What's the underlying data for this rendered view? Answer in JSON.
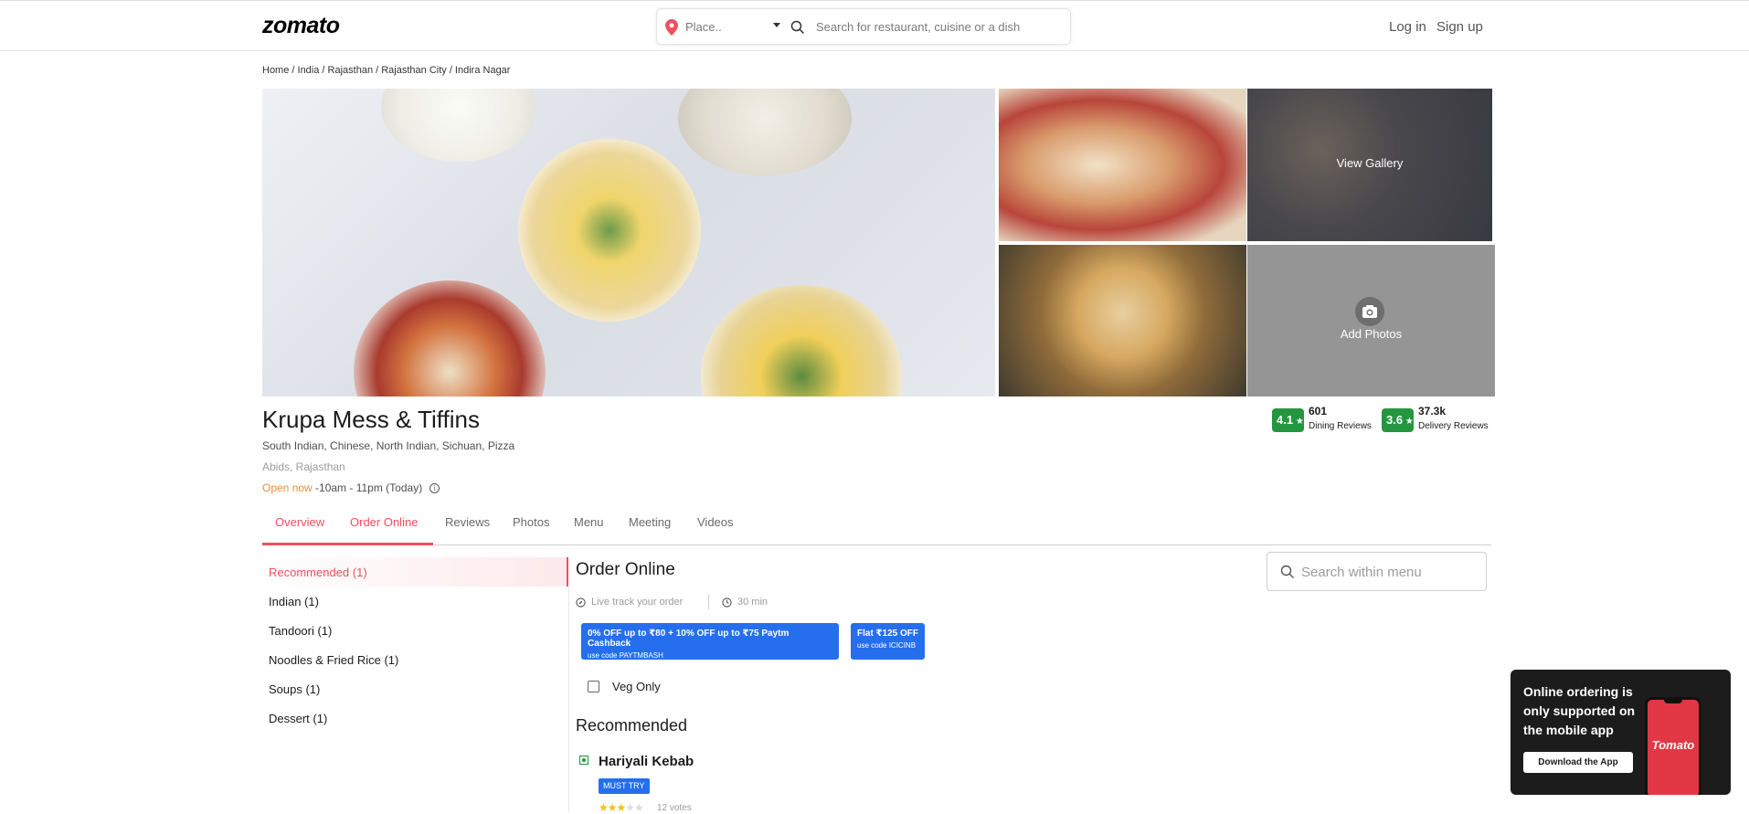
{
  "header": {
    "logo": "zomato",
    "place_placeholder": "Place..",
    "search_placeholder": "Search for restaurant, cuisine or a dish",
    "login": "Log in",
    "signup": "Sign up"
  },
  "breadcrumb": "Home / India / Rajasthan / Rajasthan City / Indira Nagar",
  "gallery": {
    "view_gallery": "View Gallery",
    "add_photos": "Add Photos"
  },
  "restaurant": {
    "name": "Krupa Mess & Tiffins",
    "cuisines": "South Indian, Chinese, North Indian, Sichuan, Pizza",
    "location": "Abids, Rajasthan",
    "open_status": "Open now",
    "hours": " -10am - 11pm (Today)"
  },
  "ratings": {
    "dining": {
      "value": "4.1",
      "count": "601",
      "label": "Dining Reviews"
    },
    "delivery": {
      "value": "3.6",
      "count": "37.3k",
      "label": "Delivery Reviews"
    }
  },
  "tabs": [
    "Overview",
    "Order Online",
    "Reviews",
    "Photos",
    "Menu",
    "Meeting",
    "Videos"
  ],
  "active_tab": "Order Online",
  "categories": [
    "Recommended (1)",
    "Indian (1)",
    "Tandoori (1)",
    "Noodles & Fried Rice (1)",
    "Soups (1)",
    "Dessert (1)"
  ],
  "order": {
    "title": "Order Online",
    "track": "Live track your order",
    "time": "30 min",
    "offers": [
      {
        "title": "0% OFF up to ₹80 + 10% OFF up to ₹75 Paytm Cashback",
        "code": "use code PAYTMBASH"
      },
      {
        "title": "Flat ₹125 OFF",
        "code": "use code ICICINB"
      }
    ],
    "veg_only": "Veg Only",
    "section_title": "Recommended",
    "item": {
      "name": "Hariyali Kebab",
      "badge": "MUST TRY",
      "rating": 3,
      "votes": "12 votes"
    },
    "menu_search_placeholder": "Search within menu"
  },
  "promo": {
    "text": "Online ordering is only supported on the mobile app",
    "button": "Download the App",
    "phone_logo": "Tomato"
  },
  "colors": {
    "brand_red": "#ef4f5f",
    "rating_green": "#24963f",
    "offer_blue": "#256fef",
    "open_orange": "#f38b34"
  }
}
